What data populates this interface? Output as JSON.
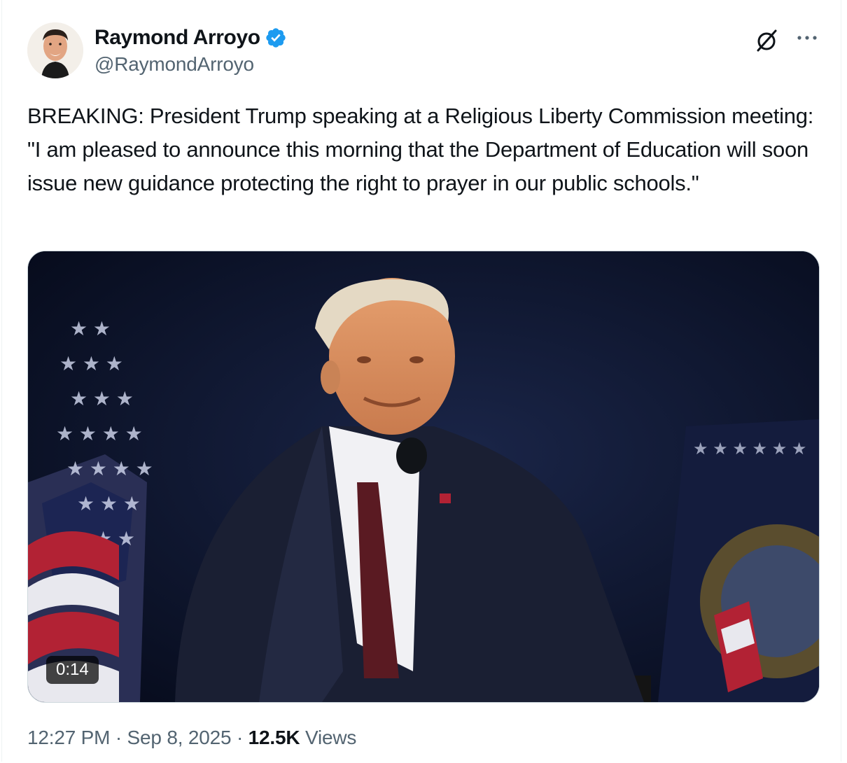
{
  "author": {
    "display_name": "Raymond Arroyo",
    "handle": "@RaymondArroyo",
    "verified": true,
    "badge_color": "#1d9bf0"
  },
  "icons": {
    "header_right": [
      "grok-icon",
      "more-options-icon"
    ],
    "verified": "verified-badge-icon"
  },
  "tweet": {
    "text": "BREAKING: President Trump speaking at a Religious Liberty Commission meeting: \"I am pleased to announce this morning that the Department of Education will soon issue new guidance protecting the right to prayer in our public schools.\""
  },
  "media": {
    "type": "video",
    "duration": "0:14"
  },
  "meta": {
    "time": "12:27 PM",
    "separator": " · ",
    "date": "Sep 8, 2025",
    "views_count": "12.5K",
    "views_label": " Views"
  },
  "colors": {
    "text_primary": "#0f1419",
    "text_secondary": "#536471",
    "border": "#cfd9de"
  }
}
